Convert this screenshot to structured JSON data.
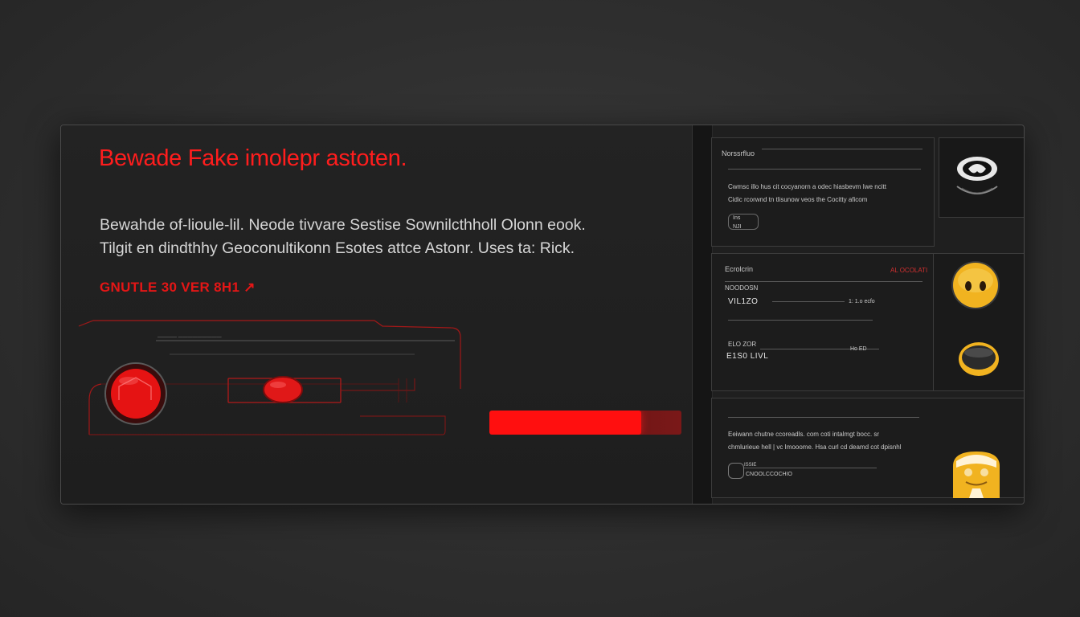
{
  "main": {
    "headline": "Bewade Fake imolepr astoten.",
    "body_line1": "Bewahde of-lioule-lil. Neode tivvare Sestise Sownilcthholl Olonn eook.",
    "body_line2": "Tilgit en dindthhy Geoconultikonn Esotes attce Astonr. Uses ta: Rick.",
    "red_label": "GNUTLE 30 VER 8H1 ↗",
    "device_caption": "———— —————————",
    "progress_percent": 79
  },
  "card1": {
    "title": "Norssrfluo",
    "line1": "Cwmsc illo hus cit cocyanorn a odec hiasbevm Iwe ncitt",
    "line2": "Cidic rcorwnd tn tlisunow veos the Cocitty aficom",
    "chip_label": "Ins",
    "chip_value": "NJI"
  },
  "card2": {
    "title": "Ecrolcrin",
    "alert": "AL OCOLATI",
    "row1_label": "NOODOSN",
    "row1_value": "VIL1ZO",
    "row1_meta": "1: 1.o ecfo",
    "row2_label": "ELO ZOR",
    "row2_value": "E1S0 LIVL",
    "row2_meta": "Ho ED"
  },
  "card3": {
    "line1": "Eeiwann chutne ccoreadls. com coti intalmgt bocc. sr",
    "line2": "chmlurieue hell | vc Imooome. Hsa curl cd deamd cot dpisnhl",
    "chip_label": "ISSIE",
    "chip_value": "CNOOLCCOCHIO"
  },
  "colors": {
    "accent_red": "#ff1d1d",
    "avatar_yellow": "#f1b320",
    "panel_bg": "#1f1f1f"
  },
  "icons": {
    "top_avatar": "masked-face-icon",
    "mid_avatar": "emoji-face-icon",
    "mid_badge": "yellow-ring-icon",
    "bottom_avatar": "bot-face-icon",
    "red_button": "red-record-button",
    "red_knob": "red-knob"
  }
}
